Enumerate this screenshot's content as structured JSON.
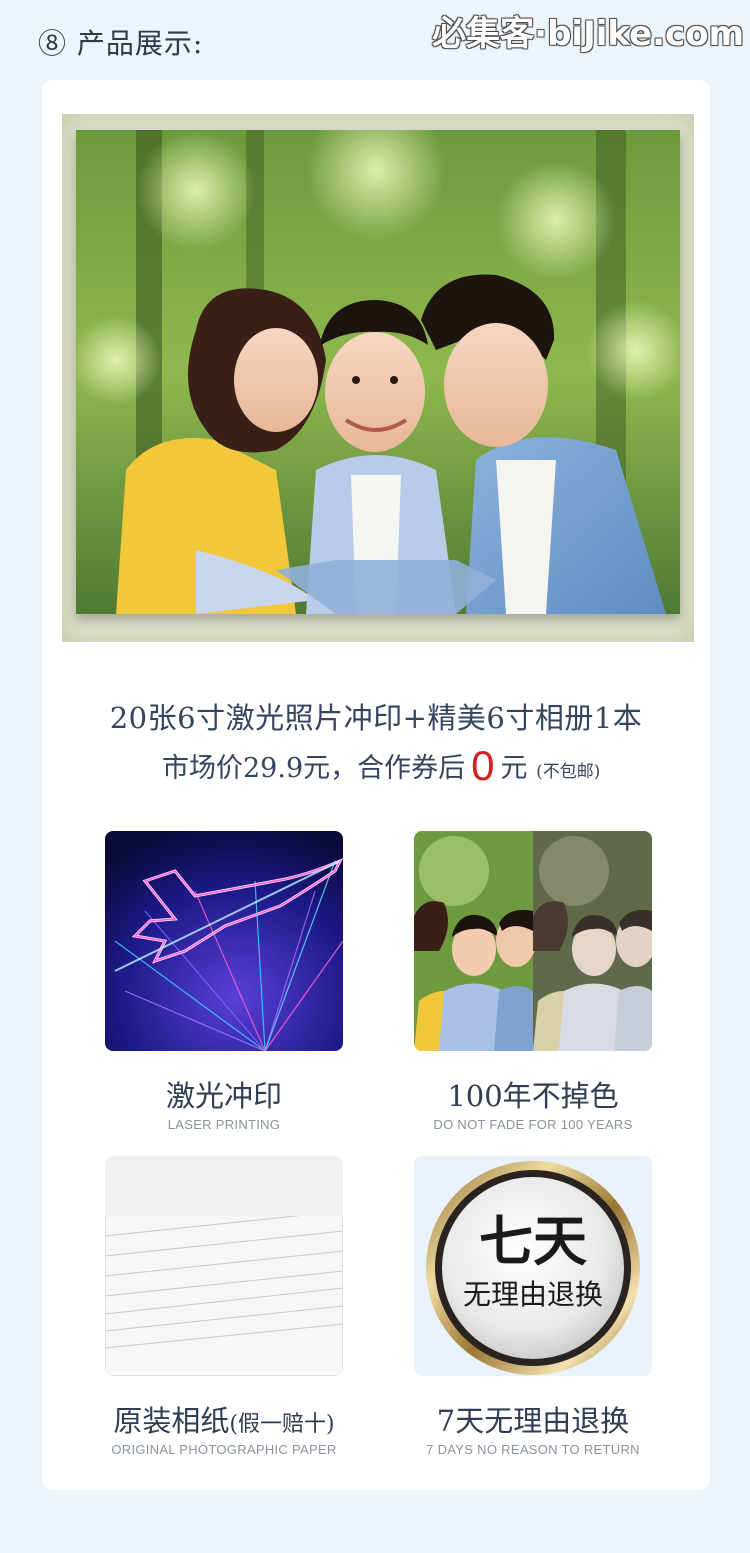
{
  "header": {
    "section_title": "⑧ 产品展示:",
    "watermark": "必集客·biJike.com"
  },
  "product": {
    "headline": "20张6寸激光照片冲印+精美6寸相册1本",
    "price_prefix": "市场价29.9元，合作券后",
    "price_value": "0",
    "price_unit": "元",
    "price_note": "(不包邮)"
  },
  "features": [
    {
      "title": "激光冲印",
      "title_suffix": "",
      "subtitle": "LASER PRINTING",
      "icon": "laser-plane-image"
    },
    {
      "title": "100年不掉色",
      "title_suffix": "",
      "subtitle": "DO NOT FADE FOR 100 YEARS",
      "icon": "fade-comparison-image"
    },
    {
      "title": "原装相纸",
      "title_suffix": "(假一赔十)",
      "subtitle": "ORIGINAL PHOTOGRAPHIC PAPER",
      "icon": "paper-stack-image"
    },
    {
      "title": "7天无理由退换",
      "title_suffix": "",
      "subtitle": "7 DAYS NO REASON TO RETURN",
      "icon": "return-badge-image",
      "badge_line1": "七天",
      "badge_line2": "无理由退换"
    }
  ],
  "colors": {
    "page_bg": "#ecf4fc",
    "card_bg": "#ffffff",
    "text": "#33455f",
    "price_accent": "#d81e1e",
    "subtitle": "#8a92a0"
  }
}
